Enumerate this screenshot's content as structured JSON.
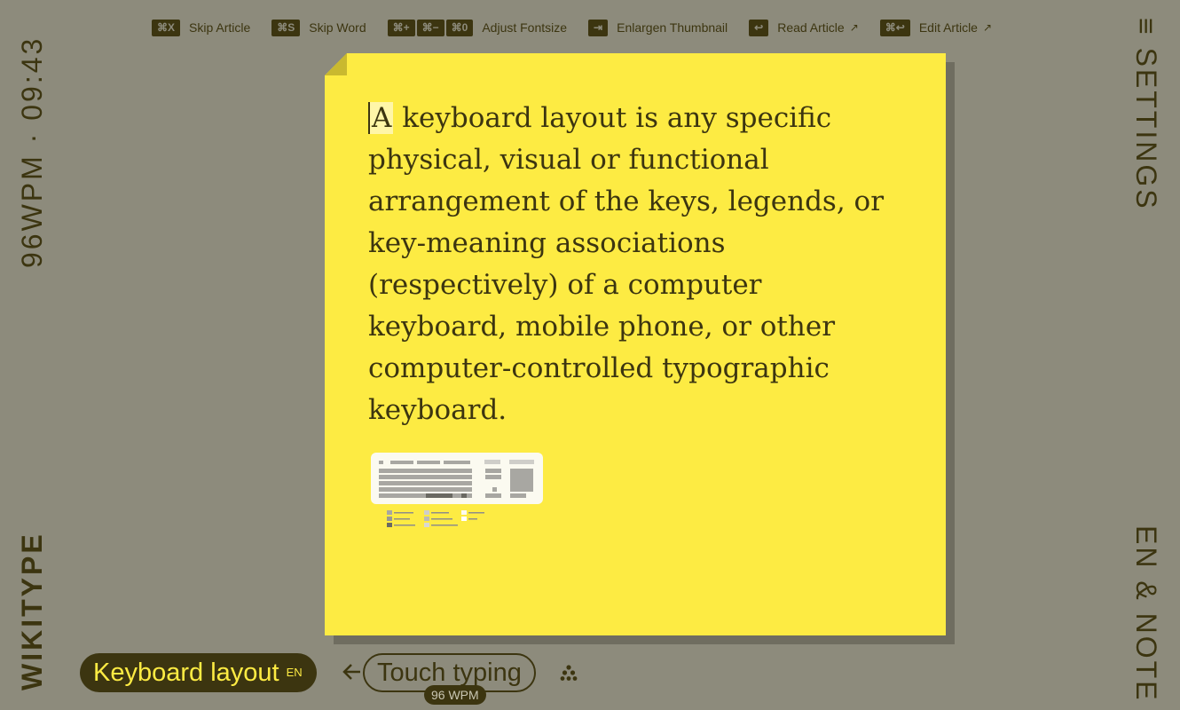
{
  "shortcuts": [
    {
      "keys": [
        "⌘X"
      ],
      "label": "Skip Article",
      "arrow": ""
    },
    {
      "keys": [
        "⌘S"
      ],
      "label": "Skip Word",
      "arrow": ""
    },
    {
      "keys": [
        "⌘+",
        "⌘−",
        "⌘0"
      ],
      "label": "Adjust Fontsize",
      "arrow": ""
    },
    {
      "keys": [
        "⇥"
      ],
      "label": "Enlargen Thumbnail",
      "arrow": ""
    },
    {
      "keys": [
        "↩"
      ],
      "label": "Read Article",
      "arrow": "↗"
    },
    {
      "keys": [
        "⌘↩"
      ],
      "label": "Edit Article",
      "arrow": "↗"
    }
  ],
  "stats": {
    "text": "96WPM · 09:43"
  },
  "brand": {
    "name": "WIKITYPE"
  },
  "settings": {
    "label": "≡ SETTINGS"
  },
  "mode": {
    "label": "EN & NOTE"
  },
  "article": {
    "first_char": "A",
    "rest": " keyboard layout is any specific physical, visual or functional arrangement of the keys, legends, or key-meaning associations (respectively) of a computer keyboard, mobile phone, or other computer-controlled typographic keyboard."
  },
  "current": {
    "title": "Keyboard layout",
    "lang": "EN"
  },
  "next": {
    "title": "Touch typing",
    "wpm": "96 WPM"
  },
  "icons": {
    "back": "arrow-left-icon",
    "cluster": "cluster-icon"
  },
  "colors": {
    "background": "#8d8b7c",
    "note": "#fdeb43",
    "ink": "#3c3510"
  }
}
